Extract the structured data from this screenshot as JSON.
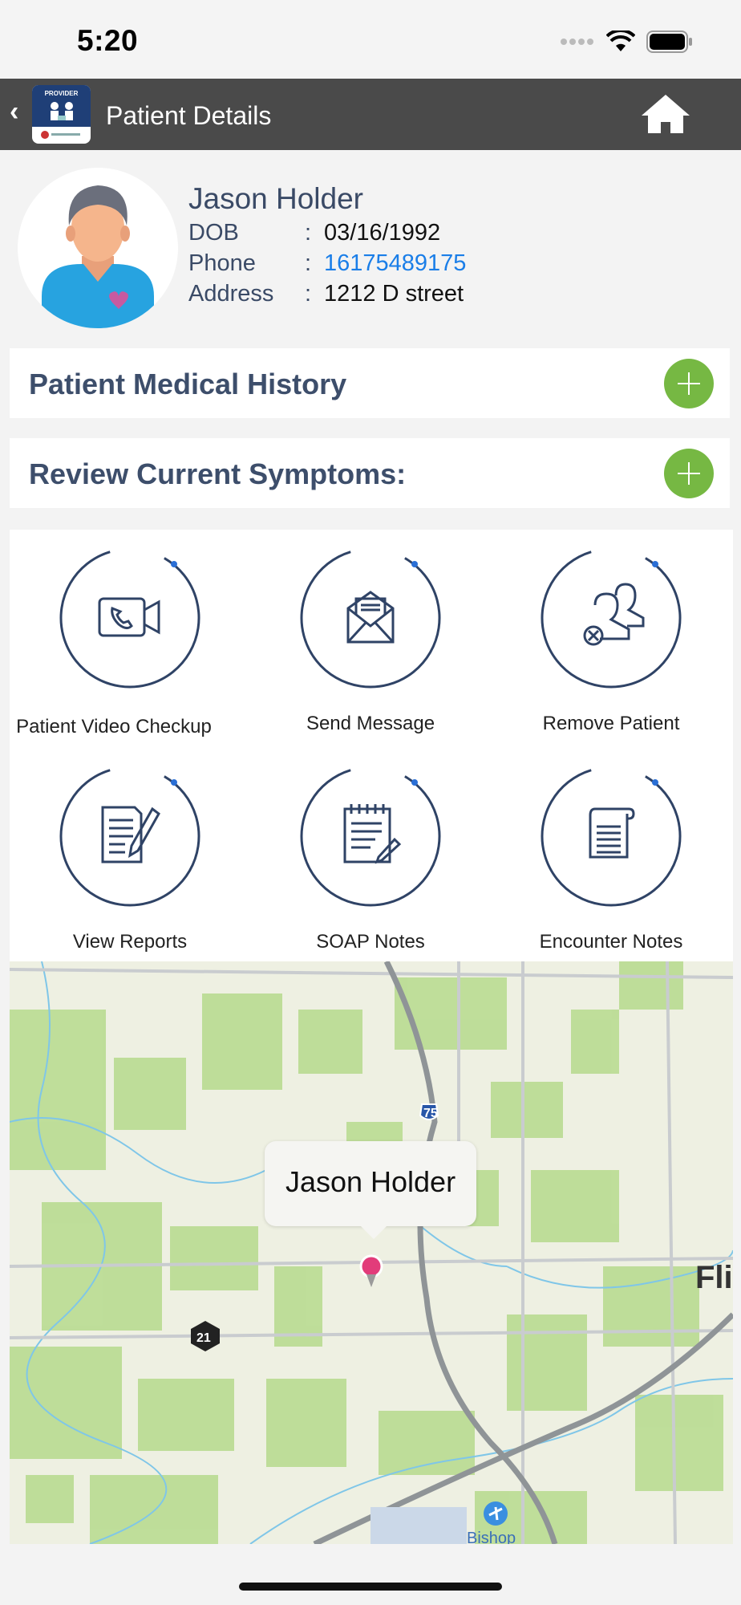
{
  "status_bar": {
    "time": "5:20"
  },
  "nav": {
    "back_icon": "chevron-left-icon",
    "logo_text": "PROVIDER",
    "title": "Patient Details",
    "home_icon": "home-icon"
  },
  "patient": {
    "name": "Jason Holder",
    "dob_label": "DOB",
    "dob": "03/16/1992",
    "phone_label": "Phone",
    "phone": "16175489175",
    "address_label": "Address",
    "address": "1212 D street",
    "colon": ":"
  },
  "sections": {
    "medical_history": "Patient Medical History",
    "symptoms": "Review Current Symptoms:"
  },
  "actions": [
    {
      "label": "Patient Video Checkup",
      "icon": "video-call-icon"
    },
    {
      "label": "Send Message",
      "icon": "envelope-icon"
    },
    {
      "label": "Remove Patient",
      "icon": "remove-user-icon"
    },
    {
      "label": "View Reports",
      "icon": "report-icon"
    },
    {
      "label": "SOAP Notes",
      "icon": "notepad-icon"
    },
    {
      "label": "Encounter Notes",
      "icon": "scroll-icon"
    }
  ],
  "map": {
    "callout_name": "Jason Holder",
    "highway_75": "75",
    "route_21": "21",
    "city_partial": "Fli",
    "airport": "Bishop"
  },
  "colors": {
    "nav_bg": "#4a4a4a",
    "accent_green": "#76b843",
    "link_blue": "#1a7ee8",
    "ring_navy": "#2f4366"
  }
}
